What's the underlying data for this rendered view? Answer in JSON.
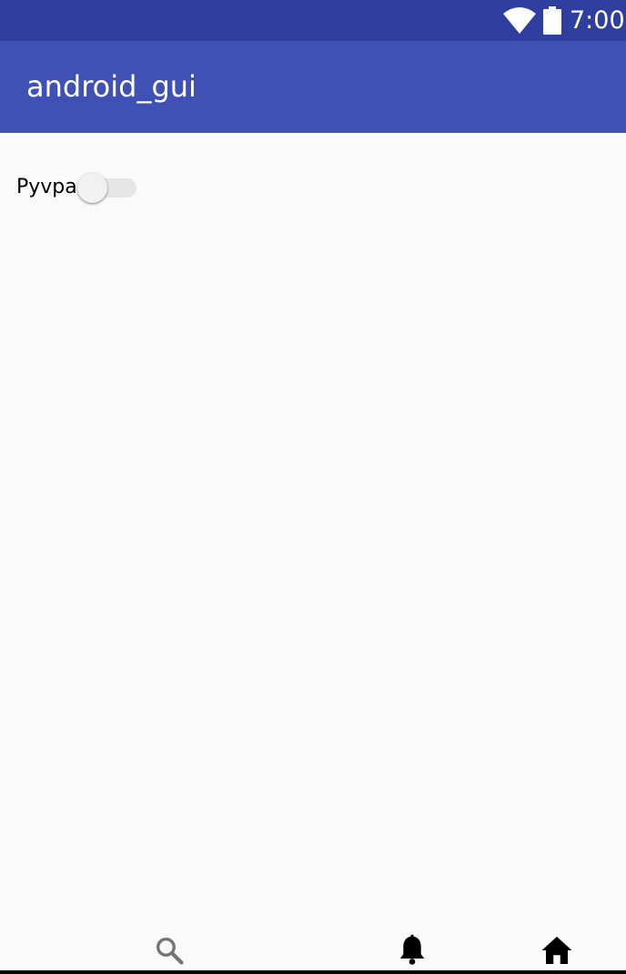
{
  "status_bar": {
    "time": "7:00",
    "icons": [
      "wifi-icon",
      "battery-icon"
    ]
  },
  "app_bar": {
    "title": "android_gui"
  },
  "content": {
    "switch_label": "Pyvpa",
    "switch_on": false
  },
  "bottom_nav": {
    "items": [
      {
        "icon": "search-icon"
      },
      {
        "icon": "bell-icon"
      },
      {
        "icon": "home-icon"
      }
    ]
  },
  "colors": {
    "status_bar": "#303f9f",
    "app_bar": "#3f51b5",
    "background": "#fafafa"
  }
}
